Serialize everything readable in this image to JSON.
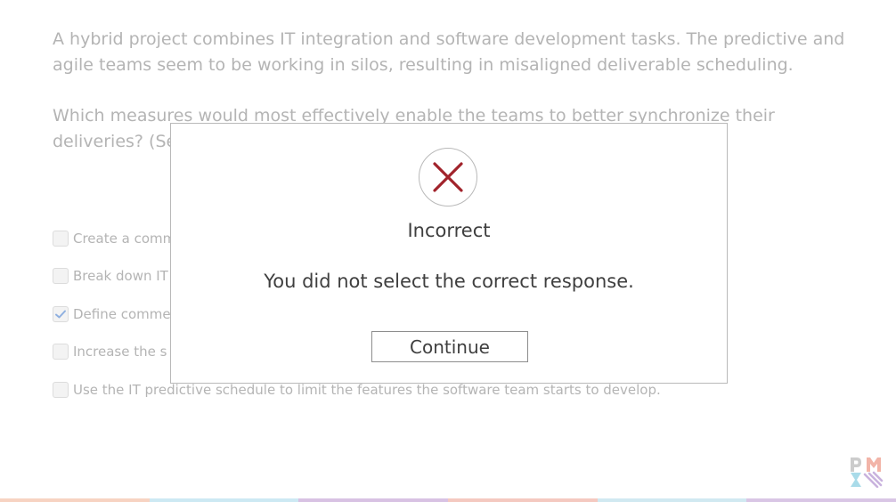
{
  "question": {
    "scenario": "A hybrid project combines IT integration and software development tasks. The predictive and agile teams seem to be working in silos, resulting in misaligned deliverable scheduling.",
    "prompt": "Which measures would most effectively enable the teams to better synchronize their deliveries? (Se"
  },
  "options": [
    {
      "label": "Create a comm",
      "checked": false
    },
    {
      "label": "Break down IT",
      "checked": false
    },
    {
      "label": "Define comme",
      "checked": true
    },
    {
      "label": "Increase the s",
      "checked": false
    },
    {
      "label": "Use the IT predictive schedule to limit the features the software team starts to develop.",
      "checked": false
    }
  ],
  "modal": {
    "icon": "x-icon",
    "title": "Incorrect",
    "message": "You did not select the correct response.",
    "button_label": "Continue"
  },
  "colors": {
    "incorrect_icon": "#a1232b",
    "checkmark": "#8fb0e0",
    "bottom_bar": [
      "#f7d3c2",
      "#cde9f3",
      "#d8c2e3",
      "#f4c9c0",
      "#d1e9f1",
      "#d9c6e5"
    ]
  },
  "logo": {
    "icon": "pmi-logo"
  }
}
